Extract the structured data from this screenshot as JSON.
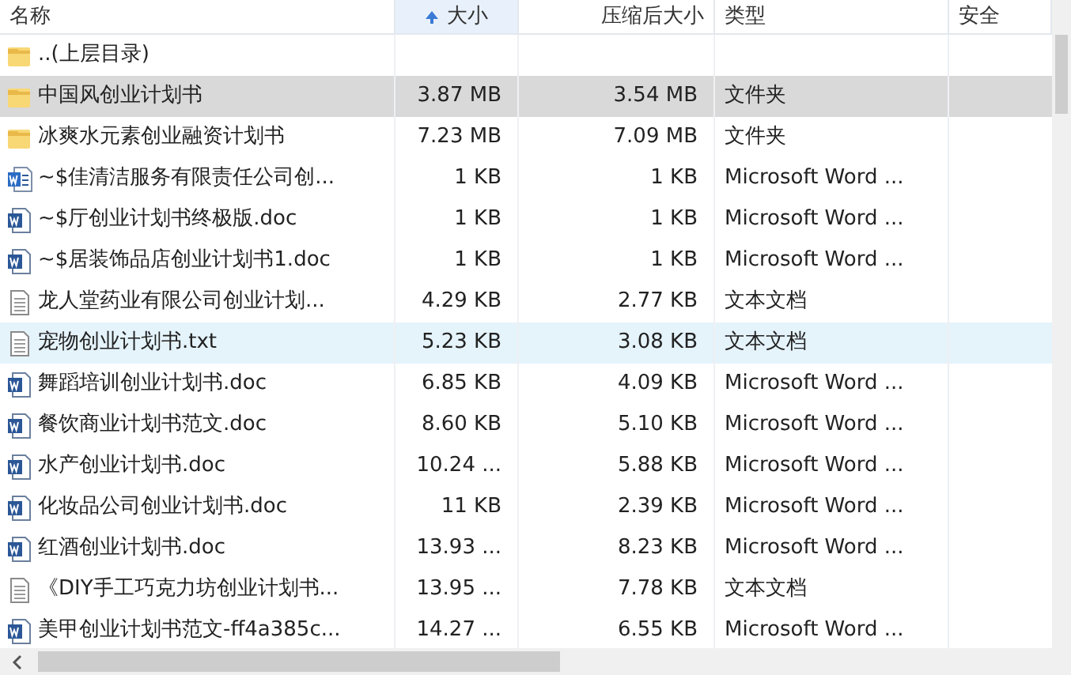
{
  "columns": [
    {
      "label": "名称",
      "sorted": false
    },
    {
      "label": "大小",
      "sorted": true
    },
    {
      "label": "压缩后大小",
      "sorted": false
    },
    {
      "label": "类型",
      "sorted": false
    },
    {
      "label": "安全",
      "sorted": false
    }
  ],
  "rows": [
    {
      "kind": "parent",
      "name": "..(上层目录)",
      "selected": false,
      "hovered": false
    },
    {
      "kind": "folder",
      "name": "中国风创业计划书",
      "size": "3.87 MB",
      "packed": "3.54 MB",
      "type": "文件夹",
      "selected": true,
      "hovered": false
    },
    {
      "kind": "folder",
      "name": "冰爽水元素创业融资计划书",
      "size": "7.23 MB",
      "packed": "7.09 MB",
      "type": "文件夹",
      "selected": false,
      "hovered": false
    },
    {
      "kind": "word-new",
      "name": "~$佳清洁服务有限责任公司创...",
      "size": "1 KB",
      "packed": "1 KB",
      "type": "Microsoft Word ...",
      "selected": false,
      "hovered": false
    },
    {
      "kind": "word",
      "name": "~$厅创业计划书终极版.doc",
      "size": "1 KB",
      "packed": "1 KB",
      "type": "Microsoft Word ...",
      "selected": false,
      "hovered": false
    },
    {
      "kind": "word",
      "name": "~$居装饰品店创业计划书1.doc",
      "size": "1 KB",
      "packed": "1 KB",
      "type": "Microsoft Word ...",
      "selected": false,
      "hovered": false
    },
    {
      "kind": "text",
      "name": "龙人堂药业有限公司创业计划...",
      "size": "4.29 KB",
      "packed": "2.77 KB",
      "type": "文本文档",
      "selected": false,
      "hovered": false
    },
    {
      "kind": "text",
      "name": "宠物创业计划书.txt",
      "size": "5.23 KB",
      "packed": "3.08 KB",
      "type": "文本文档",
      "selected": false,
      "hovered": true
    },
    {
      "kind": "word",
      "name": "舞蹈培训创业计划书.doc",
      "size": "6.85 KB",
      "packed": "4.09 KB",
      "type": "Microsoft Word ...",
      "selected": false,
      "hovered": false
    },
    {
      "kind": "word",
      "name": "餐饮商业计划书范文.doc",
      "size": "8.60 KB",
      "packed": "5.10 KB",
      "type": "Microsoft Word ...",
      "selected": false,
      "hovered": false
    },
    {
      "kind": "word",
      "name": "水产创业计划书.doc",
      "size": "10.24 ...",
      "packed": "5.88 KB",
      "type": "Microsoft Word ...",
      "selected": false,
      "hovered": false
    },
    {
      "kind": "word",
      "name": "化妆品公司创业计划书.doc",
      "size": "11 KB",
      "packed": "2.39 KB",
      "type": "Microsoft Word ...",
      "selected": false,
      "hovered": false
    },
    {
      "kind": "word",
      "name": "红酒创业计划书.doc",
      "size": "13.93 ...",
      "packed": "8.23 KB",
      "type": "Microsoft Word ...",
      "selected": false,
      "hovered": false
    },
    {
      "kind": "text",
      "name": "《DIY手工巧克力坊创业计划书...",
      "size": "13.95 ...",
      "packed": "7.78 KB",
      "type": "文本文档",
      "selected": false,
      "hovered": false
    },
    {
      "kind": "word",
      "name": "美甲创业计划书范文-ff4a385c...",
      "size": "14.27 ...",
      "packed": "6.55 KB",
      "type": "Microsoft Word ...",
      "selected": false,
      "hovered": false
    }
  ]
}
